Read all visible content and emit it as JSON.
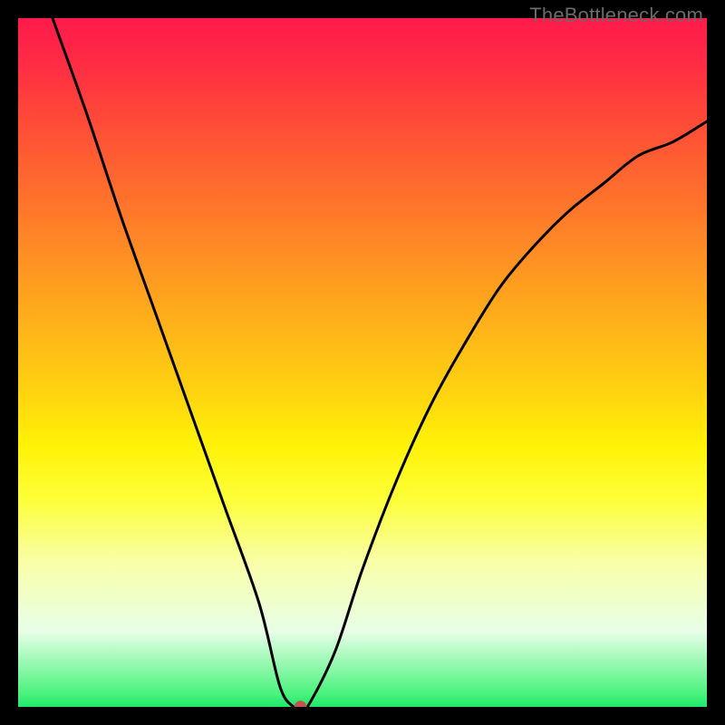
{
  "watermark": {
    "text": "TheBottleneck.com"
  },
  "chart_data": {
    "type": "line",
    "title": "",
    "xlabel": "",
    "ylabel": "",
    "xlim": [
      0,
      100
    ],
    "ylim": [
      0,
      100
    ],
    "x": [
      5,
      10,
      15,
      20,
      25,
      30,
      35,
      38,
      40,
      41,
      42,
      46,
      50,
      55,
      60,
      65,
      70,
      75,
      80,
      85,
      90,
      95,
      100
    ],
    "values": [
      100,
      86,
      71,
      57,
      43,
      29,
      15,
      3,
      0,
      0,
      0,
      8,
      20,
      33,
      44,
      53,
      61,
      67,
      72,
      76,
      80,
      82,
      85
    ],
    "marker": {
      "x": 41,
      "y": 0,
      "color": "#c6544d",
      "radius_pct": 0.9
    },
    "gradient_stops": [
      {
        "pos": 0.0,
        "color": "#ff1a4b"
      },
      {
        "pos": 0.5,
        "color": "#fff000"
      },
      {
        "pos": 0.97,
        "color": "#4cf27f"
      },
      {
        "pos": 1.0,
        "color": "#20e86a"
      }
    ]
  }
}
